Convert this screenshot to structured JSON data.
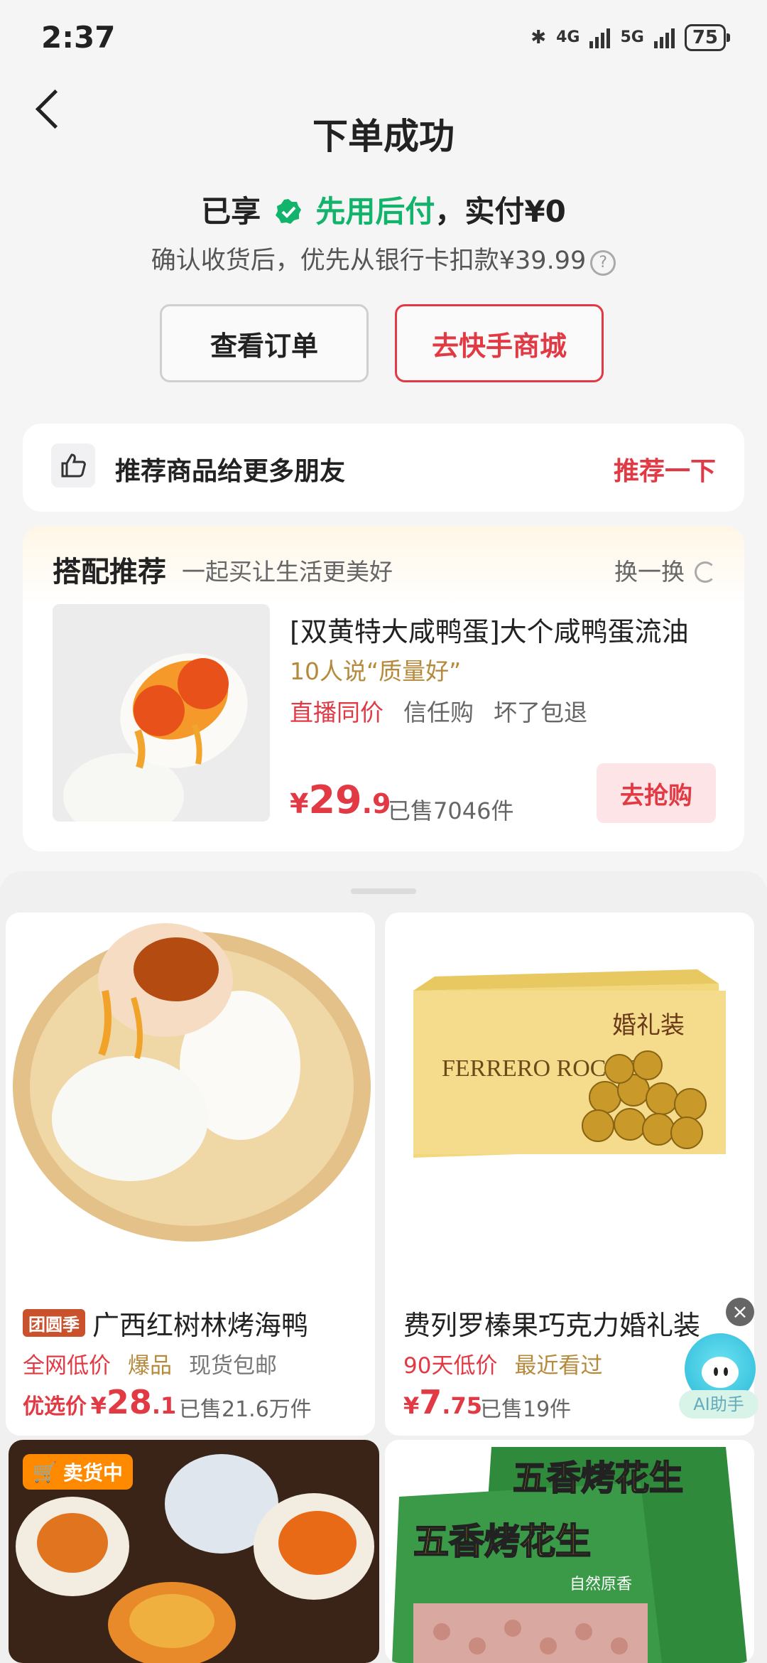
{
  "status_bar": {
    "time": "2:37",
    "network_1": "4G",
    "network_2": "5G",
    "battery": "75"
  },
  "header": {
    "title": "下单成功"
  },
  "payment": {
    "prefix": "已享",
    "method": "先用后付",
    "suffix": "，实付¥0",
    "note": "确认收货后，优先从银行卡扣款¥39.99"
  },
  "actions": {
    "view_order": "查看订单",
    "go_mall": "去快手商城"
  },
  "share": {
    "text": "推荐商品给更多朋友",
    "link": "推荐一下"
  },
  "recommend": {
    "title": "搭配推荐",
    "subtitle": "一起买让生活更美好",
    "swap": "换一换",
    "product": {
      "name": "[双黄特大咸鸭蛋]大个咸鸭蛋流油",
      "review": "10人说“质量好”",
      "tags": [
        "直播同价",
        "信任购",
        "坏了包退"
      ],
      "price_yen": "¥",
      "price_int": "29",
      "price_dec": ".9",
      "sold": "已售7046件",
      "buy_button": "去抢购"
    }
  },
  "feed": [
    {
      "badge": "团圆季",
      "name": "广西红树林烤海鸭",
      "tags": [
        "全网低价",
        "爆品",
        "现货包邮"
      ],
      "price_label": "优选价",
      "price_yen": "¥",
      "price_int": "28",
      "price_dec": ".1",
      "sold": "已售21.6万件"
    },
    {
      "name": "费列罗榛果巧克力婚礼装",
      "tags": [
        "90天低价",
        "最近看过"
      ],
      "price_yen": "¥",
      "price_int": "7",
      "price_dec": ".75",
      "sold": "已售19件",
      "box_brand": "FERRERO ROCHER",
      "box_label": "婚礼装"
    },
    {
      "live_badge": "卖货中"
    },
    {
      "bag_text": "五香烤花生",
      "bag_sub": "自然原香"
    }
  ],
  "assistant": {
    "label": "AI助手",
    "close": "×"
  },
  "colors": {
    "accent_red": "#e23a45",
    "green": "#12b46b",
    "gold": "#b58a3c"
  }
}
